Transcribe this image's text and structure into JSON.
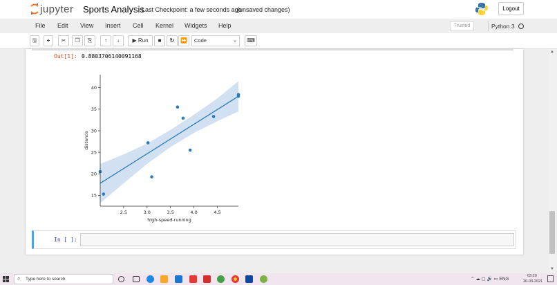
{
  "header": {
    "logo_text": "jupyter",
    "notebook_name": "Sports Analysis",
    "checkpoint": "Last Checkpoint: a few seconds ago",
    "autosave": "(unsaved changes)",
    "logout": "Logout"
  },
  "menubar": {
    "items": [
      "File",
      "Edit",
      "View",
      "Insert",
      "Cell",
      "Kernel",
      "Widgets",
      "Help"
    ],
    "trusted": "Trusted",
    "kernel": "Python 3"
  },
  "toolbar": {
    "run_label": "Run",
    "cell_type": "Code",
    "icons": [
      "save-icon",
      "add-icon",
      "cut-icon",
      "copy-icon",
      "paste-icon",
      "move-up-icon",
      "move-down-icon",
      "run-icon",
      "stop-icon",
      "restart-icon",
      "fast-forward-icon",
      "keyboard-icon"
    ]
  },
  "output": {
    "prompt": "Out[1]:",
    "value": "0.8803706140091168"
  },
  "input_cell": {
    "prompt": "In [ ]:"
  },
  "taskbar": {
    "search_placeholder": "Type here to search",
    "language": "ENG",
    "time": "03:20",
    "date": "30-03-2021"
  },
  "chart_data": {
    "type": "scatter",
    "xlabel": "high-speed-running",
    "ylabel": "distance",
    "xlim": [
      2.0,
      4.95
    ],
    "ylim": [
      12.5,
      43
    ],
    "xticks": [
      2.5,
      3.0,
      3.5,
      4.0,
      4.5
    ],
    "yticks": [
      15,
      20,
      25,
      30,
      35,
      40
    ],
    "points": [
      {
        "x": 2.0,
        "y": 20.5
      },
      {
        "x": 2.07,
        "y": 15.3
      },
      {
        "x": 3.02,
        "y": 27.2
      },
      {
        "x": 3.1,
        "y": 19.3
      },
      {
        "x": 3.65,
        "y": 35.5
      },
      {
        "x": 3.77,
        "y": 32.9
      },
      {
        "x": 3.92,
        "y": 25.5
      },
      {
        "x": 4.42,
        "y": 33.3
      },
      {
        "x": 4.95,
        "y": 38.4
      },
      {
        "x": 4.95,
        "y": 38.0
      }
    ],
    "regression": {
      "x": [
        2.0,
        4.95
      ],
      "y": [
        17.8,
        38.0
      ]
    },
    "band_upper": [
      {
        "x": 2.0,
        "y": 22.3
      },
      {
        "x": 2.5,
        "y": 24.5
      },
      {
        "x": 3.0,
        "y": 27.0
      },
      {
        "x": 3.5,
        "y": 30.2
      },
      {
        "x": 4.0,
        "y": 33.7
      },
      {
        "x": 4.5,
        "y": 37.5
      },
      {
        "x": 4.95,
        "y": 41.5
      }
    ],
    "band_lower": [
      {
        "x": 2.0,
        "y": 13.2
      },
      {
        "x": 2.5,
        "y": 17.8
      },
      {
        "x": 3.0,
        "y": 22.3
      },
      {
        "x": 3.5,
        "y": 26.2
      },
      {
        "x": 4.0,
        "y": 29.5
      },
      {
        "x": 4.5,
        "y": 32.2
      },
      {
        "x": 4.95,
        "y": 34.5
      }
    ],
    "colors": {
      "points": "#2b7bba",
      "line": "#2b7bba",
      "band": "#c9dcee"
    }
  }
}
